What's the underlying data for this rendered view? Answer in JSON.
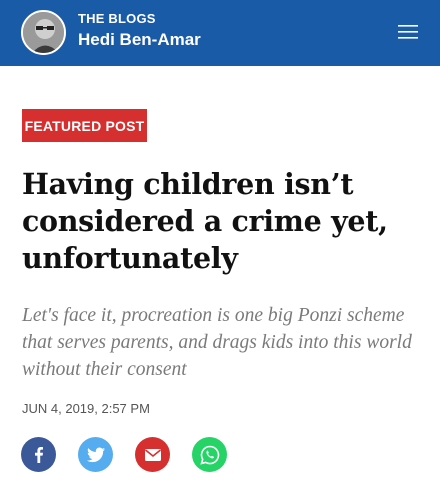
{
  "header": {
    "kicker": "THE BLOGS",
    "author": "Hedi Ben-Amar",
    "background_color": "#1a5ba8",
    "avatar_icon": "author-avatar",
    "menu_icon": "hamburger-menu-icon"
  },
  "badge": {
    "label": "FEATURED POST",
    "color": "#d62f2f"
  },
  "article": {
    "headline": "Having children isn’t considered a crime yet, unfortunately",
    "subtitle": "Let's face it, procreation is one big Ponzi scheme that serves parents, and drags kids into this world without their consent",
    "date": "JUN 4, 2019, 2:57 PM"
  },
  "share": [
    {
      "icon": "facebook-icon",
      "color": "#3b5998"
    },
    {
      "icon": "twitter-icon",
      "color": "#55acee"
    },
    {
      "icon": "email-icon",
      "color": "#d62f2f"
    },
    {
      "icon": "whatsapp-icon",
      "color": "#25d366"
    }
  ]
}
